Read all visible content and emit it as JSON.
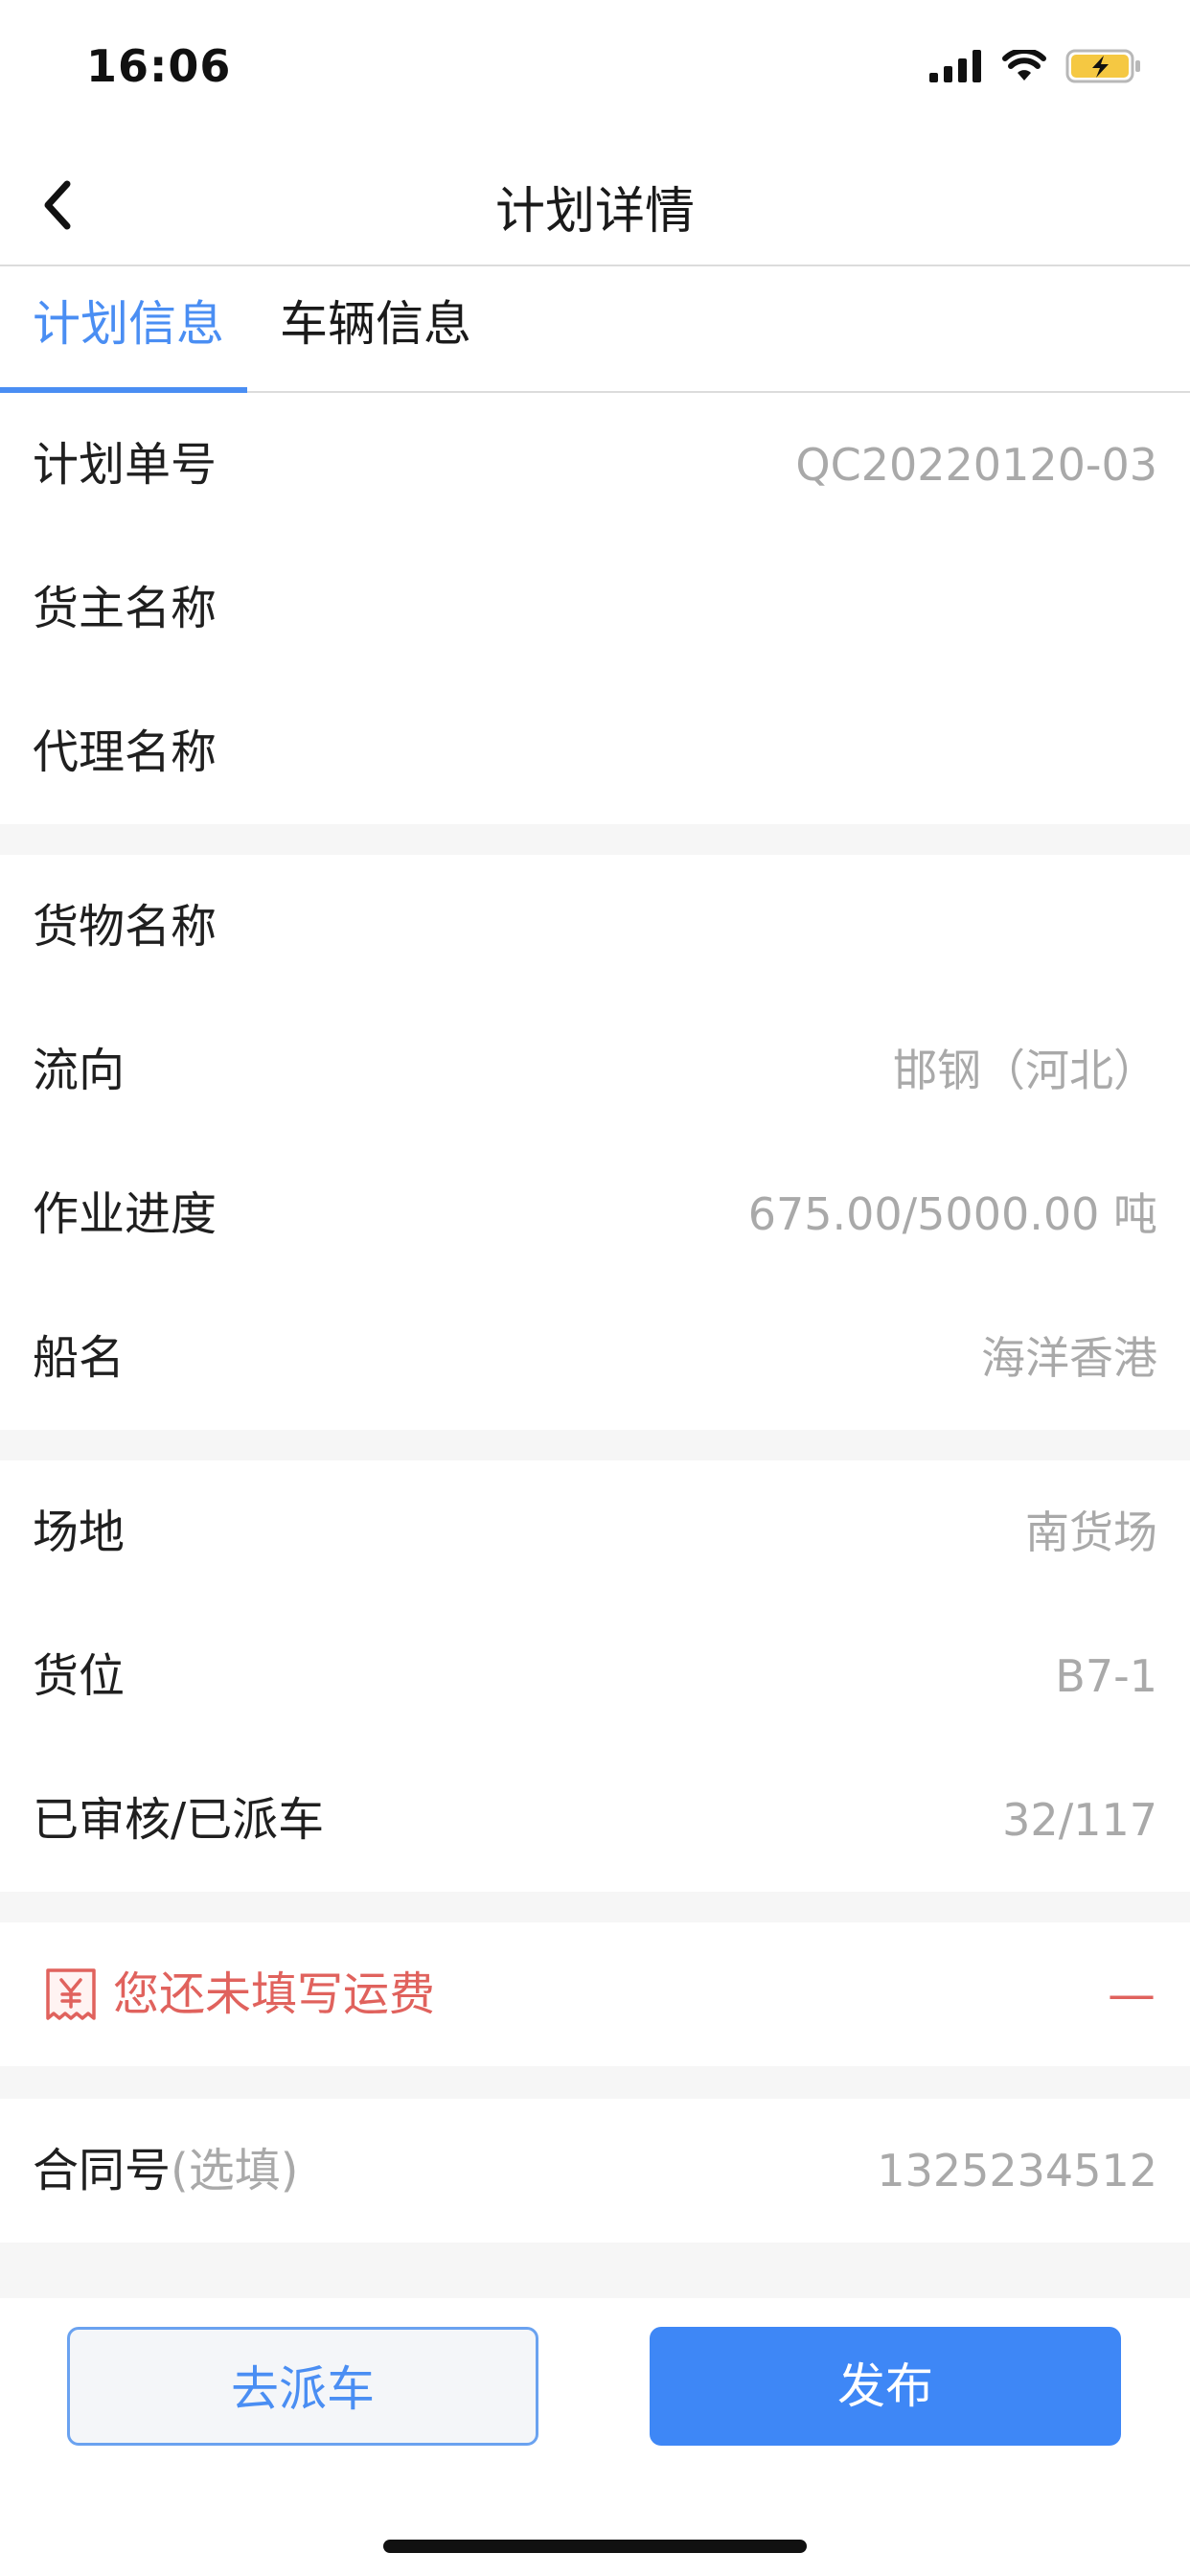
{
  "status_bar": {
    "time": "16:06",
    "icons": [
      "cellular-signal-icon",
      "wifi-icon",
      "battery-charging-icon"
    ],
    "battery_color": "#f5c842"
  },
  "nav": {
    "title": "计划详情",
    "back_icon": "chevron-left-icon"
  },
  "tabs": [
    {
      "label": "计划信息",
      "active": true
    },
    {
      "label": "车辆信息",
      "active": false
    }
  ],
  "section1": [
    {
      "label": "计划单号",
      "value": "QC20220120-03"
    },
    {
      "label": "货主名称",
      "value": ""
    },
    {
      "label": "代理名称",
      "value": ""
    }
  ],
  "section2": [
    {
      "label": "货物名称",
      "value": ""
    },
    {
      "label": "流向",
      "value": "邯钢（河北）"
    },
    {
      "label": "作业进度",
      "value": "675.00/5000.00 吨"
    },
    {
      "label": "船名",
      "value": "海洋香港"
    }
  ],
  "section3": [
    {
      "label": "场地",
      "value": "南货场"
    },
    {
      "label": "货位",
      "value": "B7-1"
    },
    {
      "label": "已审核/已派车",
      "value": "32/117"
    }
  ],
  "freight": {
    "icon": "receipt-yuan-icon",
    "text": "您还未填写运费",
    "toggle": "—",
    "color": "#e0625d"
  },
  "contract": {
    "label": "合同号",
    "hint": "(选填)",
    "value": "1325234512"
  },
  "footer": {
    "dispatch_label": "去派车",
    "publish_label": "发布"
  },
  "colors": {
    "accent": "#4a8ef3",
    "primary_button": "#3e87f6",
    "value_gray": "#a9a9a9"
  }
}
